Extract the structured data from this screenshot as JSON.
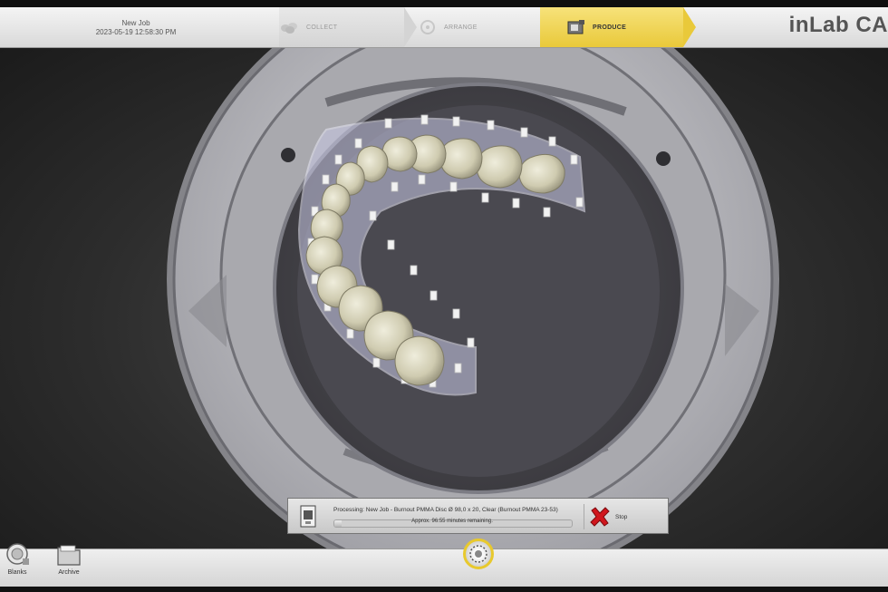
{
  "job": {
    "name": "New Job",
    "datetime": "2023-05-19 12:58:30 PM"
  },
  "workflow": {
    "steps": [
      {
        "label": "COLLECT",
        "icon": "collect-icon",
        "active": false
      },
      {
        "label": "ARRANGE",
        "icon": "arrange-icon",
        "active": false
      },
      {
        "label": "PRODUCE",
        "icon": "produce-icon",
        "active": true
      }
    ]
  },
  "brand": {
    "logo_text": "inLab CA"
  },
  "processing": {
    "status_text": "Processing: New Job - Burnout PMMA Disc Ø 98,0 x 20, Clear (Burnout PMMA 23-53)",
    "remaining_text": "Approx. 96:55 minutes remaining.",
    "progress": 0.03,
    "stop_label": "Stop"
  },
  "toolbar": {
    "blanks_label": "Blanks",
    "archive_label": "Archive"
  },
  "colors": {
    "accent": "#e9c93a",
    "stop": "#d0161d"
  }
}
